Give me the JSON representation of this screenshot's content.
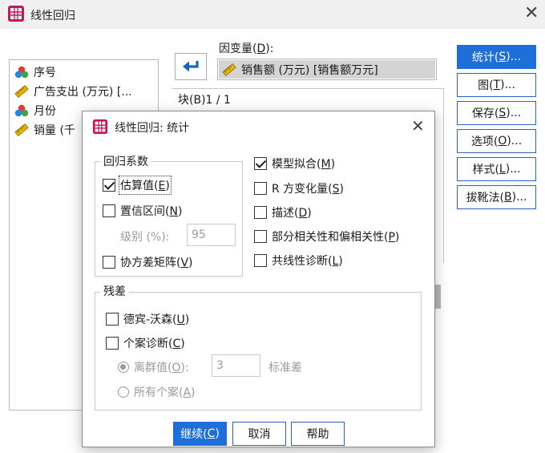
{
  "window": {
    "title": "线性回归",
    "variables": [
      "序号",
      "广告支出 (万元) [...",
      "月份",
      "销量 (千"
    ],
    "dependent": {
      "label": "因变量(D):",
      "label_pre": "因变量(",
      "label_key": "D",
      "label_post": "):",
      "value": "销售额 (万元) [销售额万元]"
    },
    "block_label": "块(B)1 / 1",
    "side_buttons": [
      {
        "pre": "统计(",
        "key": "S",
        "post": ")..."
      },
      {
        "pre": "图(",
        "key": "T",
        "post": ")..."
      },
      {
        "pre": "保存(",
        "key": "S",
        "post": ")..."
      },
      {
        "pre": "选项(",
        "key": "O",
        "post": ")..."
      },
      {
        "pre": "样式(",
        "key": "L",
        "post": ")..."
      },
      {
        "pre": "拔靴法(",
        "key": "B",
        "post": ")..."
      }
    ]
  },
  "dialog": {
    "title": "线性回归: 统计",
    "coef_group": "回归系数",
    "estimates": {
      "pre": "估算值(",
      "key": "E",
      "post": ")",
      "checked": true
    },
    "conf_intervals": {
      "pre": "置信区间(",
      "key": "N",
      "post": ")",
      "checked": false
    },
    "level_label": "级别 (%):",
    "level_value": "95",
    "covariance": {
      "pre": "协方差矩阵(",
      "key": "V",
      "post": ")",
      "checked": false
    },
    "model_fit": {
      "pre": "模型拟合(",
      "key": "M",
      "post": ")",
      "checked": true
    },
    "r_change": {
      "pre": "R 方变化量(",
      "key": "S",
      "post": ")",
      "checked": false
    },
    "descriptives": {
      "pre": "描述(",
      "key": "D",
      "post": ")",
      "checked": false
    },
    "part_partial": {
      "pre": "部分相关性和偏相关性(",
      "key": "P",
      "post": ")",
      "checked": false
    },
    "collinearity": {
      "pre": "共线性诊断(",
      "key": "L",
      "post": ")",
      "checked": false
    },
    "residuals_group": "残差",
    "durbin_watson": {
      "pre": "德宾-沃森(",
      "key": "U",
      "post": ")",
      "checked": false
    },
    "casewise": {
      "pre": "个案诊断(",
      "key": "C",
      "post": ")",
      "checked": false
    },
    "outliers": {
      "pre": "离群值(",
      "key": "O",
      "post": "):"
    },
    "outliers_value": "3",
    "std_label": "标准差",
    "all_cases": {
      "pre": "所有个案(",
      "key": "A",
      "post": ")"
    },
    "continue_btn": {
      "pre": "继续(",
      "key": "C",
      "post": ")"
    },
    "cancel_btn": "取消",
    "help_btn": "帮助"
  },
  "colors": {
    "accent": "#1e6fd9",
    "selection": "#d4d4d4"
  }
}
